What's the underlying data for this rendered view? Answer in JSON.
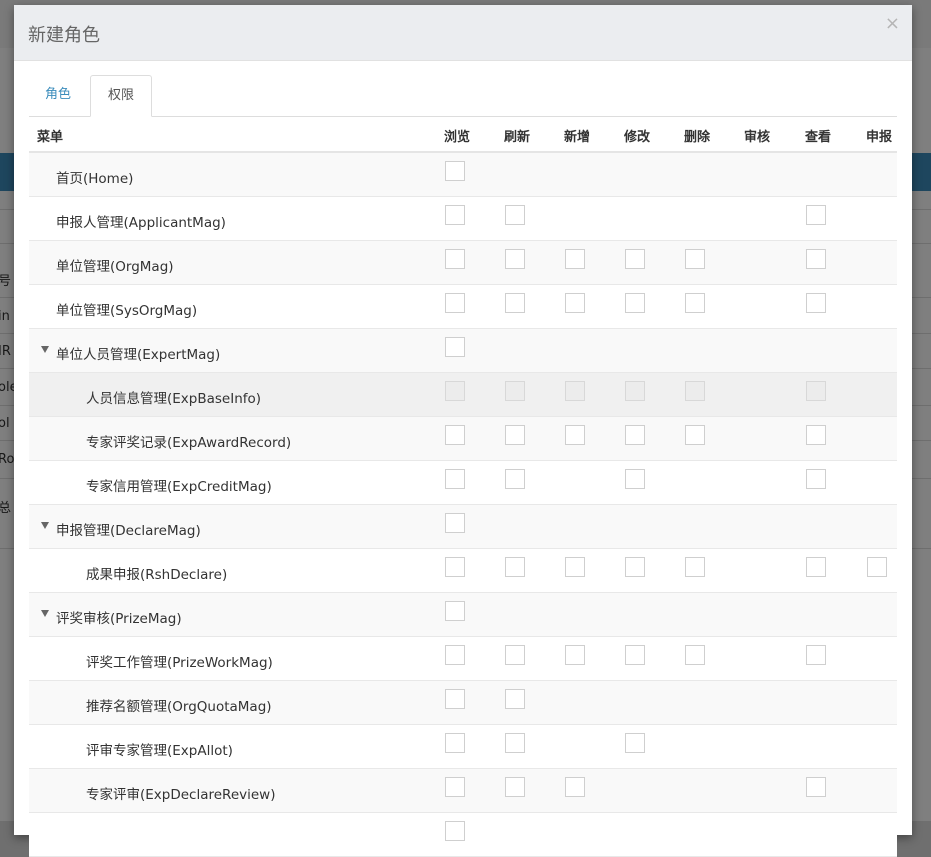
{
  "modal": {
    "title": "新建角色",
    "close_symbol": "×"
  },
  "tabs": [
    {
      "label": "角色"
    },
    {
      "label": "权限"
    }
  ],
  "background": {
    "side_texts": [
      "号",
      "in",
      "IR",
      "ole",
      "ol",
      "Ro",
      "总"
    ]
  },
  "table": {
    "menu_header": "菜单",
    "columns": [
      "浏览",
      "刷新",
      "新增",
      "修改",
      "删除",
      "审核",
      "查看",
      "申报"
    ],
    "rows": [
      {
        "label": "首页(Home)",
        "level": 0,
        "expandable": false,
        "perms": [
          1,
          0,
          0,
          0,
          0,
          0,
          0,
          0
        ]
      },
      {
        "label": "申报人管理(ApplicantMag)",
        "level": 0,
        "expandable": false,
        "perms": [
          1,
          1,
          0,
          0,
          0,
          0,
          1,
          0
        ]
      },
      {
        "label": "单位管理(OrgMag)",
        "level": 0,
        "expandable": false,
        "perms": [
          1,
          1,
          1,
          1,
          1,
          0,
          1,
          0
        ]
      },
      {
        "label": "单位管理(SysOrgMag)",
        "level": 0,
        "expandable": false,
        "perms": [
          1,
          1,
          1,
          1,
          1,
          0,
          1,
          0
        ]
      },
      {
        "label": "单位人员管理(ExpertMag)",
        "level": 0,
        "expandable": true,
        "perms": [
          1,
          0,
          0,
          0,
          0,
          0,
          0,
          0
        ]
      },
      {
        "label": "人员信息管理(ExpBaseInfo)",
        "level": 1,
        "expandable": false,
        "perms": [
          1,
          1,
          1,
          1,
          1,
          0,
          1,
          0
        ]
      },
      {
        "label": "专家评奖记录(ExpAwardRecord)",
        "level": 1,
        "expandable": false,
        "perms": [
          1,
          1,
          1,
          1,
          1,
          0,
          1,
          0
        ]
      },
      {
        "label": "专家信用管理(ExpCreditMag)",
        "level": 1,
        "expandable": false,
        "perms": [
          1,
          1,
          0,
          1,
          0,
          0,
          1,
          0
        ]
      },
      {
        "label": "申报管理(DeclareMag)",
        "level": 0,
        "expandable": true,
        "perms": [
          1,
          0,
          0,
          0,
          0,
          0,
          0,
          0
        ]
      },
      {
        "label": "成果申报(RshDeclare)",
        "level": 1,
        "expandable": false,
        "perms": [
          1,
          1,
          1,
          1,
          1,
          0,
          1,
          1
        ]
      },
      {
        "label": "评奖审核(PrizeMag)",
        "level": 0,
        "expandable": true,
        "perms": [
          1,
          0,
          0,
          0,
          0,
          0,
          0,
          0
        ]
      },
      {
        "label": "评奖工作管理(PrizeWorkMag)",
        "level": 1,
        "expandable": false,
        "perms": [
          1,
          1,
          1,
          1,
          1,
          0,
          1,
          0
        ]
      },
      {
        "label": "推荐名额管理(OrgQuotaMag)",
        "level": 1,
        "expandable": false,
        "perms": [
          1,
          1,
          0,
          0,
          0,
          0,
          0,
          0
        ]
      },
      {
        "label": "评审专家管理(ExpAllot)",
        "level": 1,
        "expandable": false,
        "perms": [
          1,
          1,
          0,
          1,
          0,
          0,
          0,
          0
        ]
      },
      {
        "label": "专家评审(ExpDeclareReview)",
        "level": 1,
        "expandable": false,
        "perms": [
          1,
          1,
          1,
          0,
          0,
          0,
          1,
          0
        ]
      },
      {
        "label": "",
        "level": 1,
        "expandable": false,
        "perms": [
          1,
          0,
          0,
          0,
          0,
          0,
          0,
          0
        ]
      }
    ]
  }
}
